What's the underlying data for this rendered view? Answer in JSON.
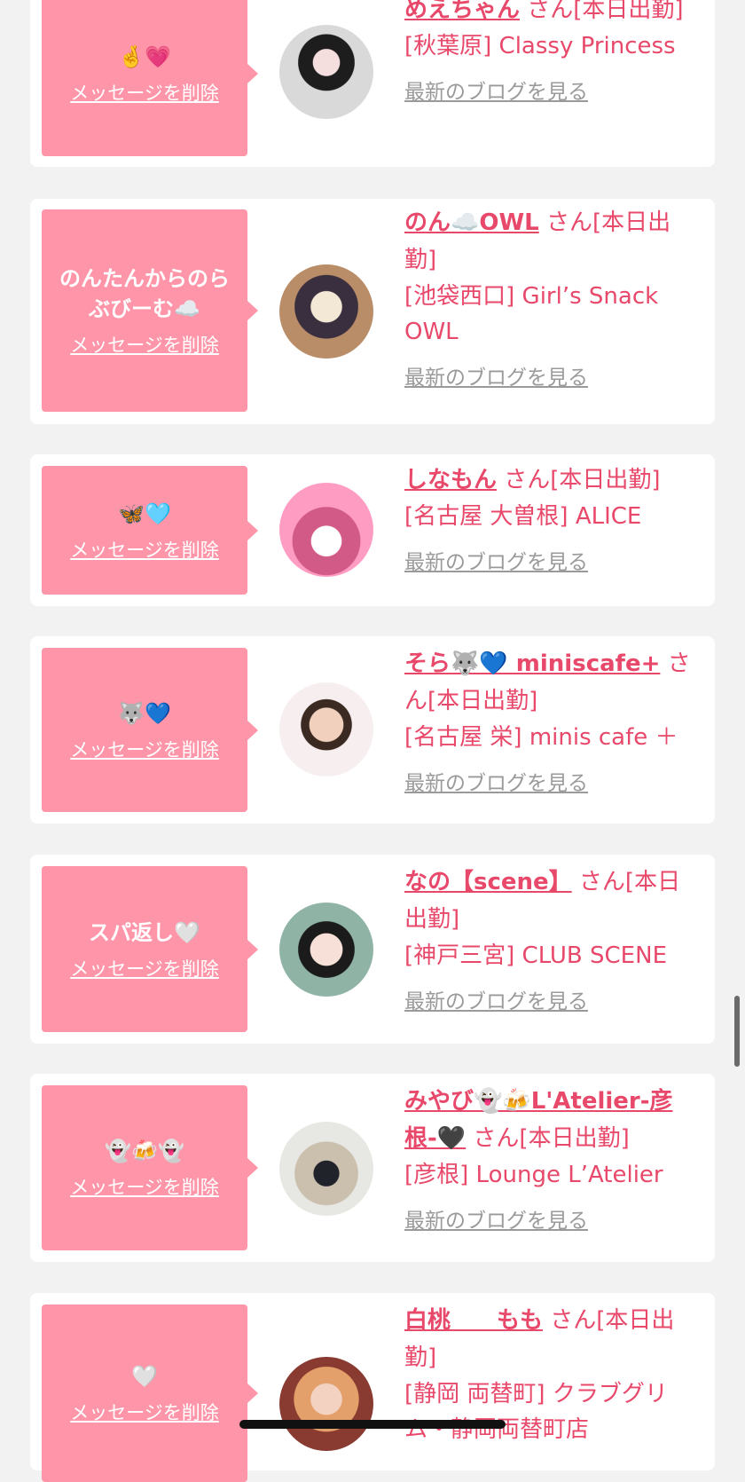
{
  "colors": {
    "accent": "#e8486a",
    "bubble": "#ff95a8",
    "link_gray": "#9a9a9a",
    "background": "#f2f2f2"
  },
  "delete_label": "メッセージを削除",
  "blog_label": "最新のブログを見る",
  "entries": [
    {
      "message": "🤞💗",
      "name": "めえちゃん",
      "suffix": " さん[本日出勤]",
      "shop": "[秋葉原] Classy Princess",
      "avatar_icon": "avatar-photo"
    },
    {
      "message": "のんたんからのらぶびーむ☁️",
      "name": "のん☁️OWL",
      "suffix": " さん[本日出勤]",
      "shop": "[池袋西口] Girl’s Snack OWL",
      "avatar_icon": "avatar-photo"
    },
    {
      "message": "🦋🩵",
      "name": "しなもん",
      "suffix": " さん[本日出勤]",
      "shop": "[名古屋 大曽根] ALICE",
      "avatar_icon": "avatar-photo"
    },
    {
      "message": "🐺💙",
      "name": "そら🐺💙 miniscafe+",
      "suffix": " さん[本日出勤]",
      "shop": "[名古屋 栄] minis cafe ＋",
      "avatar_icon": "avatar-photo"
    },
    {
      "message": "スパ返し🤍",
      "name": "なの【scene】",
      "suffix": " さん[本日出勤]",
      "shop": "[神戸三宮] CLUB SCENE",
      "avatar_icon": "avatar-photo"
    },
    {
      "message": "👻🍻👻",
      "name": "みやび👻🍻L'Atelier-彦根-🖤",
      "suffix": " さん[本日出勤]",
      "shop": "[彦根] Lounge L’Atelier",
      "avatar_icon": "avatar-photo"
    },
    {
      "message": "🤍",
      "name": "白桃　　もも",
      "suffix": " さん[本日出勤]",
      "shop": "[静岡 両替町] クラブグリム・静岡両替町店",
      "avatar_icon": "avatar-photo"
    }
  ]
}
